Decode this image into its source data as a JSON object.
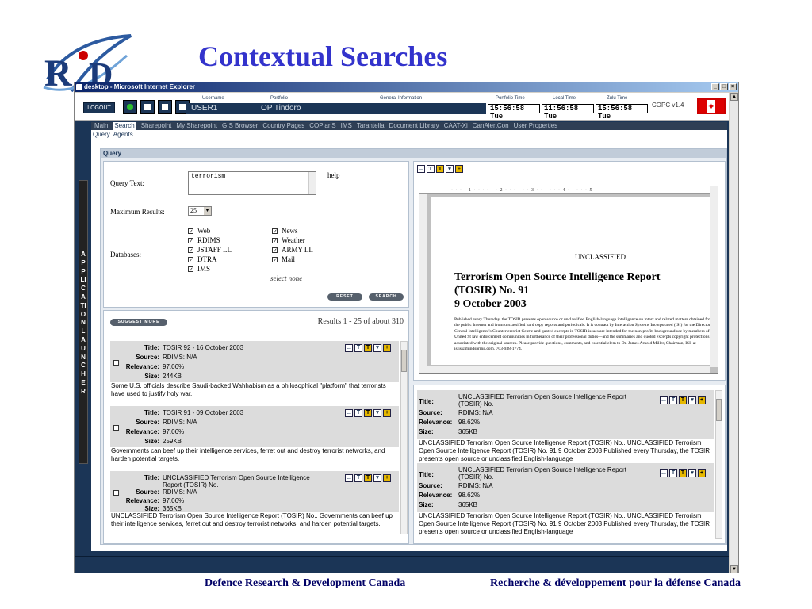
{
  "slide": {
    "logo_text": "R D",
    "title": "Contextual Searches",
    "footer_left": "Defence Research & Development Canada",
    "footer_right": "Recherche & développement pour la défense Canada"
  },
  "window": {
    "title": "desktop - Microsoft Internet Explorer",
    "buttons": [
      "_",
      "□",
      "×"
    ]
  },
  "topbar": {
    "logout_label": "LOGOUT",
    "username_label": "Username",
    "username": "USER1",
    "portfolio_label": "Portfolio",
    "portfolio": "OP Tindoro",
    "general_label": "General Information",
    "portfolio_time_label": "Portfolio Time",
    "portfolio_time": "15:56:58 Tue",
    "local_time_label": "Local Time",
    "local_time": "11:56:58 Tue",
    "zulu_time_label": "Zulu Time",
    "zulu_time": "15:56:58 Tue",
    "version": "COPC  v1.4"
  },
  "launcher_text": "APPLICATION LAUNCHER",
  "nav": {
    "tabs": [
      "Main",
      "Search",
      "Sharepoint",
      "My Sharepoint",
      "GIS Browser",
      "Country Pages",
      "COPlanS",
      "IMS",
      "Tarantella",
      "Document Library",
      "CAAT-Xi",
      "CanAlertCon",
      "User Properties"
    ],
    "active_tab": "Search",
    "subtabs": [
      "Query",
      "Agents"
    ]
  },
  "query": {
    "header": "Query",
    "query_text_label": "Query Text:",
    "query_text": "terrorism",
    "help_label": "help",
    "max_results_label": "Maximum Results:",
    "max_results": "25",
    "databases_label": "Databases:",
    "databases_left": [
      {
        "label": "Web",
        "checked": true
      },
      {
        "label": "RDIMS",
        "checked": true
      },
      {
        "label": "JSTAFF LL",
        "checked": true
      },
      {
        "label": "DTRA",
        "checked": true
      },
      {
        "label": "IMS",
        "checked": true
      }
    ],
    "databases_right": [
      {
        "label": "News",
        "checked": true
      },
      {
        "label": "Weather",
        "checked": true
      },
      {
        "label": "ARMY LL",
        "checked": true
      },
      {
        "label": "Mail",
        "checked": true
      }
    ],
    "select_none": "select none",
    "reset_label": "RESET",
    "search_label": "SEARCH"
  },
  "results": {
    "suggest_label": "SUGGEST MORE",
    "count_text": "Results 1 - 25 of about 310",
    "labels": {
      "title": "Title:",
      "source": "Source:",
      "relevance": "Relevance:",
      "size": "Size:"
    },
    "items": [
      {
        "title": "TOSIR 92 - 16 October 2003",
        "source": "RDIMS: N/A",
        "relevance": "97.06%",
        "size": "244KB",
        "summary": "Some U.S. officials describe Saudi-backed Wahhabism as a philosophical \"platform\" that terrorists have used to justify holy war."
      },
      {
        "title": "TOSIR 91 - 09 October 2003",
        "source": "RDIMS: N/A",
        "relevance": "97.06%",
        "size": "259KB",
        "summary": "Governments can beef up their intelligence services, ferret out and destroy terrorist networks, and harden potential targets."
      },
      {
        "title": "UNCLASSIFIED Terrorism Open Source Intelligence Report (TOSIR) No.",
        "source": "RDIMS: N/A",
        "relevance": "97.06%",
        "size": "365KB",
        "summary": "UNCLASSIFIED Terrorism Open Source Intelligence Report (TOSIR) No.. Governments can beef up their intelligence services, ferret out and destroy terrorist networks, and harden potential targets."
      }
    ]
  },
  "document": {
    "ruler_text": "· · · · 1 · · · · · · 2 · · · · · · 3 · · · · · · 4 · · · · · 5",
    "classification": "UNCLASSIFIED",
    "title_line1": "Terrorism Open Source Intelligence Report",
    "title_line2": "(TOSIR) No. 91",
    "title_line3": "9 October 2003",
    "body": "Published every Thursday, the TOSIR presents open source or unclassified English-language intelligence on interr and related matters obtained from the public Internet and from unclassified hard copy reports and periodicals. It is contract by Interaction Systems Incorporated (ISI) for the Director of Central Intelligence's Counterterrorist Centre and quoted excerpts in TOSIR issues are intended for the non-profit, background use by members of the United St law enforcement communities in furtherance of their professional duties—and the summaries and quoted excerpts copyright protections associated with the original sources. Please provide questions, comments, and essential elem to Dr. James Arnold Miller, Chairman, ISI, at isiis@mindspring.com, 703-938-1774."
  },
  "related": {
    "items": [
      {
        "title": "UNCLASSIFIED Terrorism Open Source Intelligence Report (TOSIR) No.",
        "source": "RDIMS: N/A",
        "relevance": "98.62%",
        "size": "365KB",
        "summary": "UNCLASSIFIED Terrorism Open Source Intelligence Report (TOSIR) No.. UNCLASSIFIED Terrorism Open Source Intelligence Report (TOSIR) No. 91 9 October 2003 Published every Thursday, the TOSIR presents open source or unclassified English-language"
      },
      {
        "title": "UNCLASSIFIED Terrorism Open Source Intelligence Report (TOSIR) No.",
        "source": "RDIMS: N/A",
        "relevance": "98.62%",
        "size": "365KB",
        "summary": "UNCLASSIFIED Terrorism Open Source Intelligence Report (TOSIR) No.. UNCLASSIFIED Terrorism Open Source Intelligence Report (TOSIR) No. 91 9 October 2003 Published every Thursday, the TOSIR presents open source or unclassified English-language"
      }
    ]
  },
  "colors": {
    "accent": "#3333cc",
    "app_bg": "#1b3556",
    "footer": "#000066"
  }
}
